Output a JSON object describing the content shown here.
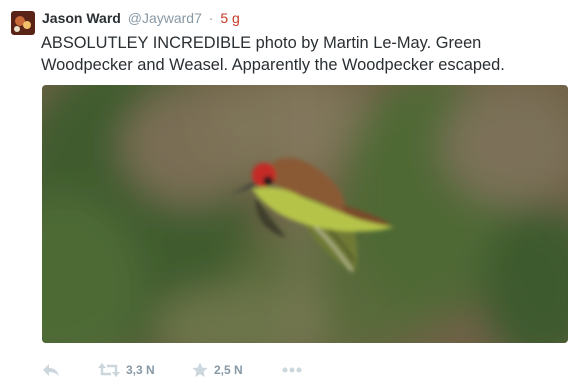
{
  "tweet": {
    "display_name": "Jason Ward",
    "handle": "@Jayward7",
    "separator": "·",
    "timestamp": "5 g",
    "text_line1": "ABSOLUTLEY INCREDIBLE photo by Martin Le-May. Green",
    "text_line2": "Woodpecker and Weasel. Apparently the Woodpecker escaped."
  },
  "actions": {
    "retweet_count": "3,3 N",
    "favorite_count": "2,5 N"
  },
  "colors": {
    "name": "#292f33",
    "muted": "#8899a6",
    "timestamp": "#c63a25",
    "icon": "#ccd6dd"
  },
  "icons": [
    "avatar",
    "reply-icon",
    "retweet-icon",
    "star-icon",
    "more-icon"
  ]
}
